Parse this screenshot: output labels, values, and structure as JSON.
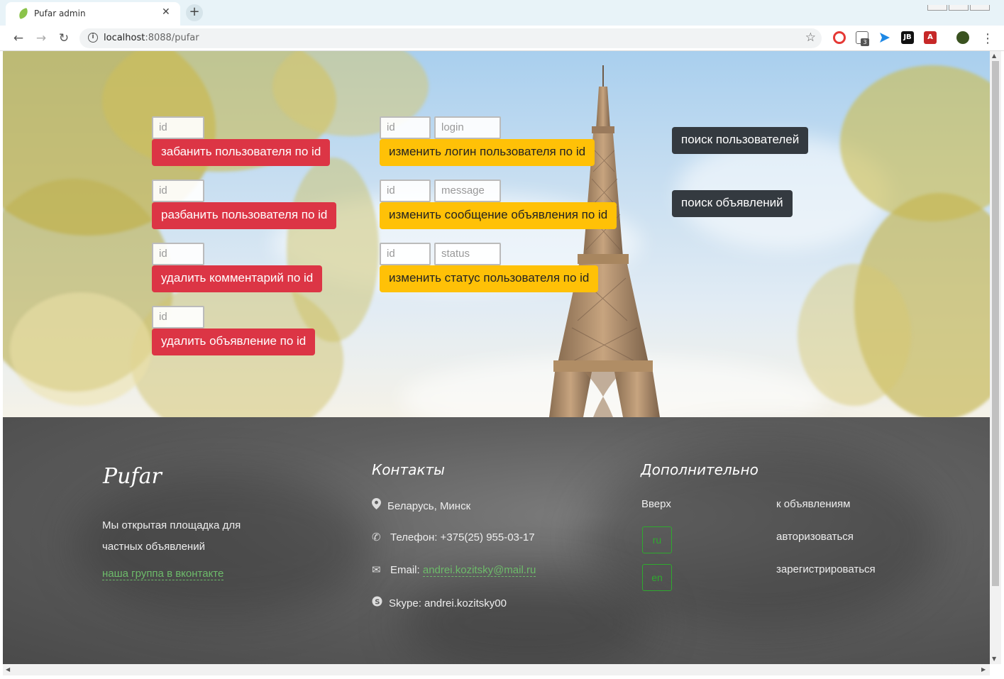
{
  "browser": {
    "tab_title": "Pufar admin",
    "tab_close": "✕",
    "new_tab": "+",
    "url_host": "localhost",
    "url_rest": ":8088/pufar",
    "ext_badge_count": "3",
    "ext_jb_label": "JB"
  },
  "admin": {
    "id_placeholder": "id",
    "login_placeholder": "login",
    "message_placeholder": "message",
    "status_placeholder": "status",
    "ban_user": "забанить пользователя по id",
    "unban_user": "разбанить пользователя по id",
    "delete_comment": "удалить комментарий по id",
    "delete_ad": "удалить объявление по id",
    "change_login": "изменить логин пользователя по id",
    "change_message": "изменить сообщение объявления по id",
    "change_status": "изменить статус пользователя по id",
    "search_users": "поиск пользователей",
    "search_ads": "поиск объявлений"
  },
  "footer": {
    "brand": "Pufar",
    "about": "Мы открытая площадка для частных объявлений",
    "vk_link": "наша группа в вконтакте",
    "contacts_title": "Контакты",
    "location": "Беларусь, Минск",
    "phone": "Телефон: +375(25) 955-03-17",
    "email_label": "Email:",
    "email": "andrei.kozitsky@mail.ru",
    "skype": "Skype: andrei.kozitsky00",
    "extra_title": "Дополнительно",
    "up": "Вверх",
    "lang_ru": "ru",
    "lang_en": "en",
    "to_ads": "к объявлениям",
    "login": "авторизоваться",
    "register": "зарегистрироваться"
  },
  "colors": {
    "danger": "#dc3545",
    "warning": "#ffc107",
    "dark": "#343a40",
    "link_green": "#6dbb6a",
    "lang_green": "#2eaa2e"
  }
}
